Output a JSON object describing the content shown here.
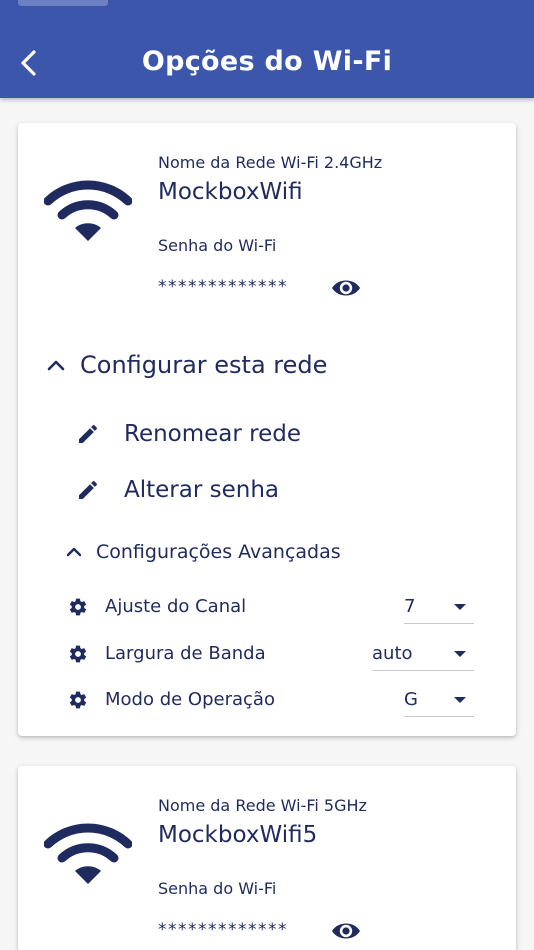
{
  "appbar": {
    "title": "Opções do Wi-Fi",
    "back_icon": "chevron-left-icon",
    "background": "#3c56ac"
  },
  "networks": [
    {
      "label": "Nome da Rede Wi-Fi 2.4GHz",
      "name": "MockboxWifi",
      "password_label": "Senha do Wi-Fi",
      "password_masked": "*************",
      "configure_label": "Configurar esta rede",
      "actions": [
        {
          "label": "Renomear rede",
          "icon": "pencil-icon"
        },
        {
          "label": "Alterar senha",
          "icon": "pencil-icon"
        }
      ],
      "advanced_label": "Configurações Avançadas",
      "settings": [
        {
          "label": "Ajuste do Canal",
          "value": "7",
          "icon": "gear-icon"
        },
        {
          "label": "Largura de Banda",
          "value": "auto",
          "icon": "gear-icon"
        },
        {
          "label": "Modo de Operação",
          "value": "G",
          "icon": "gear-icon"
        }
      ]
    },
    {
      "label": "Nome da Rede Wi-Fi 5GHz",
      "name": "MockboxWifi5",
      "password_label": "Senha do Wi-Fi",
      "password_masked": "*************"
    }
  ],
  "colors": {
    "primary": "#3c56ac",
    "text": "#1f2a5e",
    "icon": "#1f2a5e"
  }
}
